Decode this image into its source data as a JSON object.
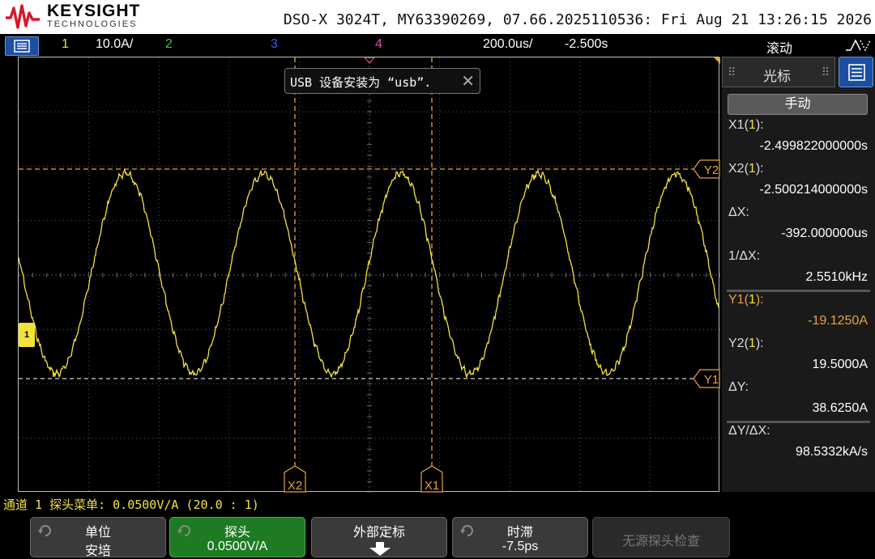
{
  "brand": {
    "name": "KEYSIGHT",
    "sub": "TECHNOLOGIES"
  },
  "instrument": "DSO-X 3024T, MY63390269, 07.66.2025110536: Fri Aug 21 13:26:15 2026",
  "status": {
    "ch1_num": "1",
    "ch1_scale": "10.0A/",
    "ch2_num": "2",
    "ch3_num": "3",
    "ch4_num": "4",
    "timebase": "200.0us/",
    "delay": "-2.500s",
    "mode": "滚动"
  },
  "colors": {
    "ch1": "#f3e23b",
    "ch2": "#3cc24a",
    "ch3": "#3a5cf0",
    "ch4": "#e44aa5",
    "cursor": "#e8a33a",
    "accent": "#1c4fa0"
  },
  "toast": {
    "text": "USB 设备安装为 “usb”."
  },
  "cursors": {
    "x1_label": "X1",
    "x2_label": "X2",
    "y1_label": "Y1",
    "y2_label": "Y2",
    "ground_label": "1"
  },
  "panel": {
    "title": "光标",
    "mode": "手动",
    "measurements": [
      {
        "label_pre": "X1(",
        "ch": "1",
        "label_post": "):",
        "value": "-2.499822000000s"
      },
      {
        "label_pre": "X2(",
        "ch": "1",
        "label_post": "):",
        "value": "-2.500214000000s"
      },
      {
        "label_pre": "ΔX:",
        "ch": "",
        "label_post": "",
        "value": "-392.000000us"
      },
      {
        "label_pre": "1/ΔX:",
        "ch": "",
        "label_post": "",
        "value": "2.5510kHz"
      },
      {
        "label_pre": "Y1(",
        "ch": "1",
        "label_post": "):",
        "value": "-19.1250A"
      },
      {
        "label_pre": "Y2(",
        "ch": "1",
        "label_post": "):",
        "value": "19.5000A"
      },
      {
        "label_pre": "ΔY:",
        "ch": "",
        "label_post": "",
        "value": "38.6250A"
      },
      {
        "label_pre": "ΔY/ΔX:",
        "ch": "",
        "label_post": "",
        "value": "98.5332kA/s"
      }
    ]
  },
  "probe_line": "通道 1 探头菜单: 0.0500V/A (20.0 : 1)",
  "softkeys": [
    {
      "l1": "单位",
      "l2": "安培",
      "state": "normal",
      "knob": true
    },
    {
      "l1": "探头",
      "l2": "0.0500V/A",
      "state": "active",
      "knob": true
    },
    {
      "l1": "外部定标",
      "l2": "",
      "state": "normal",
      "arrow": true
    },
    {
      "l1": "时滞",
      "l2": "-7.5ps",
      "state": "normal",
      "knob": true
    },
    {
      "l1": "无源探头检查",
      "l2": "",
      "state": "disabled"
    }
  ]
}
